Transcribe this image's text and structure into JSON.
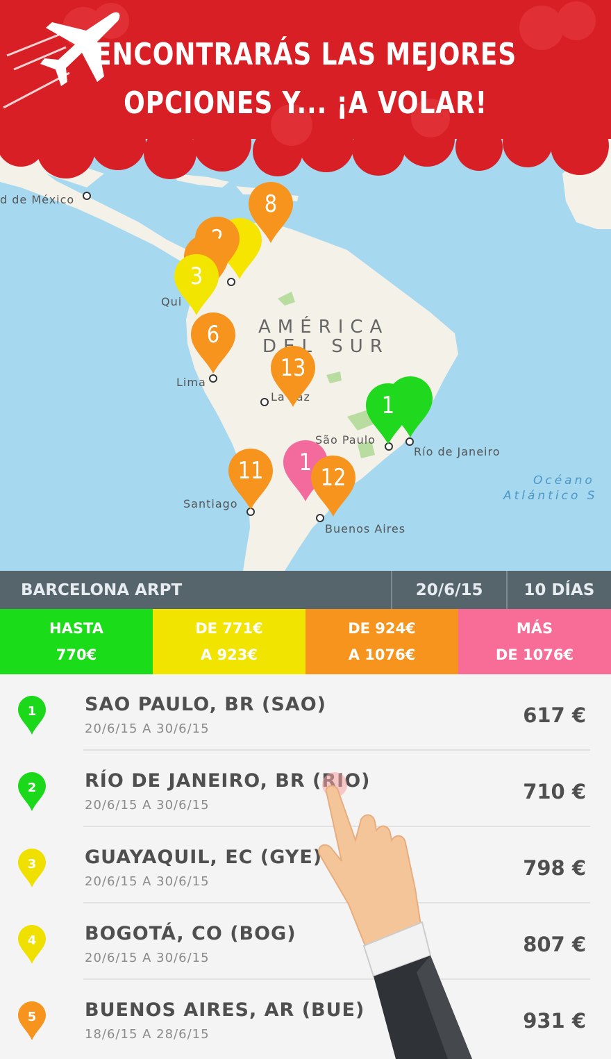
{
  "header": {
    "line1": "ENCONTRARÁS LAS MEJORES",
    "line2": "OPCIONES Y... ¡A VOLAR!",
    "icon": "airplane-icon",
    "background_color": "#d81f26"
  },
  "map": {
    "labels": {
      "mexico": "d de México",
      "quito": "Qui",
      "america_line1": "AMÉRICA",
      "america_line2": "DEL SUR",
      "lima": "Lima",
      "la_paz": "La Paz",
      "sao_paulo": "São Paulo",
      "rio": "Río de Janeiro",
      "ocean_line1": "Océano",
      "ocean_line2": "Atlántico S",
      "santiago": "Santiago",
      "buenos_aires": "Buenos Aires"
    },
    "pins": [
      {
        "label": "8",
        "color": "#f7941d"
      },
      {
        "label": "2",
        "color": "#f7941d"
      },
      {
        "label": "3",
        "color": "#f2e600"
      },
      {
        "label": "6",
        "color": "#f7941d"
      },
      {
        "label": "13",
        "color": "#f7941d"
      },
      {
        "label": "1",
        "color": "#20d91f"
      },
      {
        "label": "11",
        "color": "#f7941d"
      },
      {
        "label": "1",
        "color": "#f26b9c"
      },
      {
        "label": "12",
        "color": "#f7941d"
      }
    ]
  },
  "info_bar": {
    "origin": "BARCELONA ARPT",
    "date": "20/6/15",
    "duration": "10 DÍAS"
  },
  "legend": [
    {
      "line1": "HASTA",
      "line2": "770€",
      "color": "#1bdc19"
    },
    {
      "line1": "DE 771€",
      "line2": "A 923€",
      "color": "#f1e400"
    },
    {
      "line1": "DE 924€",
      "line2": "A 1076€",
      "color": "#f7941d"
    },
    {
      "line1": "MÁS",
      "line2": "DE 1076€",
      "color": "#f76d98"
    }
  ],
  "results": [
    {
      "rank": "1",
      "city": "SAO PAULO, BR (SAO)",
      "dates": "20/6/15 A 30/6/15",
      "price": "617 €",
      "color": "#1bd91a"
    },
    {
      "rank": "2",
      "city": "RÍO DE JANEIRO, BR (RIO)",
      "dates": "20/6/15 A 30/6/15",
      "price": "710 €",
      "color": "#1bd91a"
    },
    {
      "rank": "3",
      "city": "GUAYAQUIL, EC (GYE)",
      "dates": "20/6/15 A 30/6/15",
      "price": "798 €",
      "color": "#f0e000"
    },
    {
      "rank": "4",
      "city": "BOGOTÁ, CO (BOG)",
      "dates": "20/6/15 A 30/6/15",
      "price": "807 €",
      "color": "#f0e000"
    },
    {
      "rank": "5",
      "city": "BUENOS AIRES, AR (BUE)",
      "dates": "18/6/15 A 28/6/15",
      "price": "931 €",
      "color": "#f7941d"
    }
  ]
}
